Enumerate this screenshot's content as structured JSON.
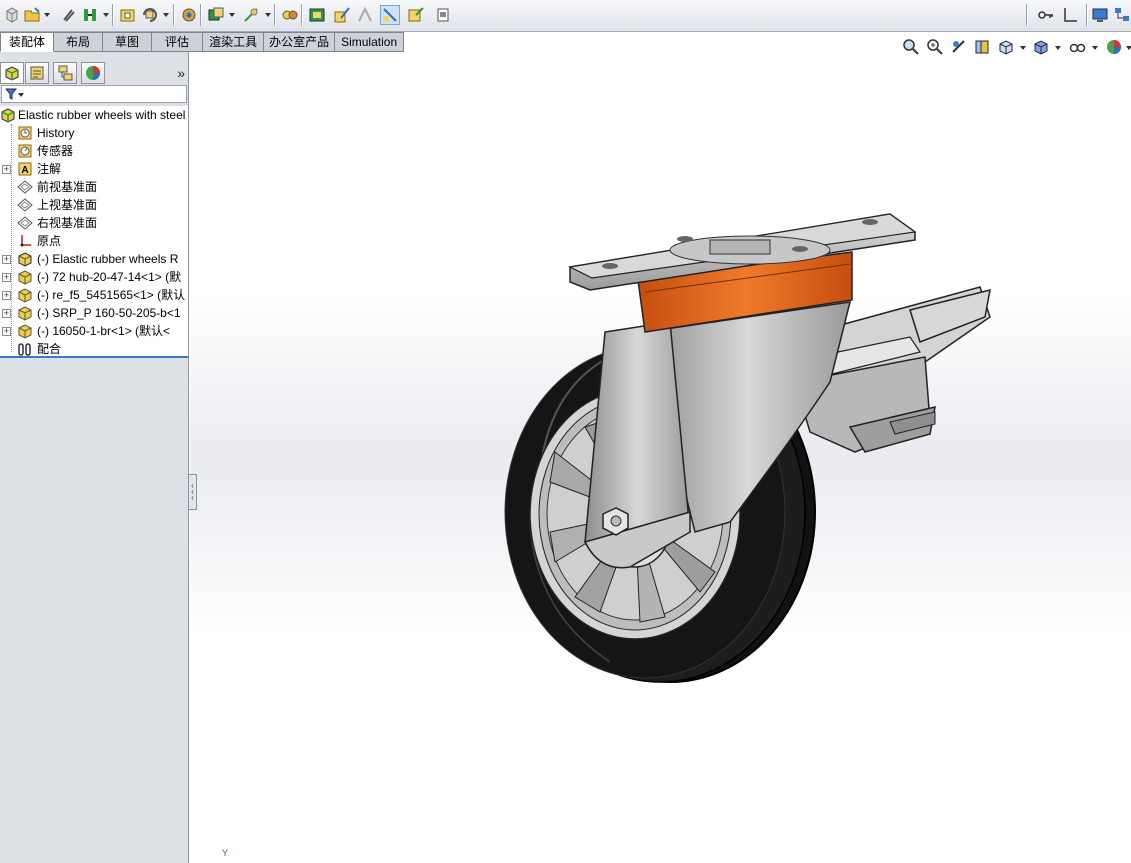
{
  "toolbar": {
    "buttons": [
      "new-icon",
      "open-icon",
      "attach-icon",
      "mate-icon",
      "insert-component-icon",
      "smart-fastener-icon",
      "exploded-view-icon",
      "interference-icon",
      "hide-show-icon",
      "reference-geometry-icon",
      "assembly-feature-icon",
      "sketch-icon",
      "selected-view-icon",
      "note-icon"
    ],
    "right_buttons": [
      "key-icon",
      "axis-icon",
      "monitor-icon",
      "network-icon"
    ]
  },
  "tabs": [
    {
      "label": "装配体",
      "active": true
    },
    {
      "label": "布局",
      "active": false
    },
    {
      "label": "草图",
      "active": false
    },
    {
      "label": "评估",
      "active": false
    },
    {
      "label": "渲染工具",
      "active": false
    },
    {
      "label": "办公室产品",
      "active": false
    },
    {
      "label": "Simulation",
      "active": false
    }
  ],
  "view_tools": [
    "zoom-to-fit-icon",
    "zoom-to-area-icon",
    "previous-view-icon",
    "section-view-icon",
    "view-orientation-icon",
    "display-style-icon",
    "hide-show-items-icon",
    "appearance-icon"
  ],
  "panel": {
    "tabs": [
      "feature-manager-icon",
      "property-manager-icon",
      "configuration-manager-icon",
      "display-manager-icon"
    ],
    "expand_glyph": "»"
  },
  "tree": {
    "root": "Elastic rubber wheels with steel",
    "items": [
      {
        "label": "History",
        "icon": "history-icon",
        "expandable": false
      },
      {
        "label": "传感器",
        "icon": "sensor-icon",
        "expandable": false
      },
      {
        "label": "注解",
        "icon": "annotation-icon",
        "expandable": true
      },
      {
        "label": "前视基准面",
        "icon": "plane-icon",
        "expandable": false
      },
      {
        "label": "上视基准面",
        "icon": "plane-icon",
        "expandable": false
      },
      {
        "label": "右视基准面",
        "icon": "plane-icon",
        "expandable": false
      },
      {
        "label": "原点",
        "icon": "origin-icon",
        "expandable": false
      },
      {
        "label": "(-) Elastic rubber wheels R",
        "icon": "subassembly-icon",
        "expandable": true
      },
      {
        "label": "(-) 72 hub-20-47-14<1> (默",
        "icon": "part-icon",
        "expandable": true
      },
      {
        "label": "(-) re_f5_5451565<1> (默认",
        "icon": "part-icon",
        "expandable": true
      },
      {
        "label": "(-) SRP_P 160-50-205-b<1",
        "icon": "part-icon",
        "expandable": true
      },
      {
        "label": "(-) 16050-1-br<1> (默认<",
        "icon": "part-icon",
        "expandable": true
      },
      {
        "label": "配合",
        "icon": "mates-icon",
        "expandable": false
      }
    ]
  },
  "triad": {
    "y_label": "Y"
  },
  "colors": {
    "accent_orange": "#e8661e",
    "tire": "#1a1a1a",
    "steel": "#c9c9c9",
    "selection_blue": "#3c78c8"
  }
}
